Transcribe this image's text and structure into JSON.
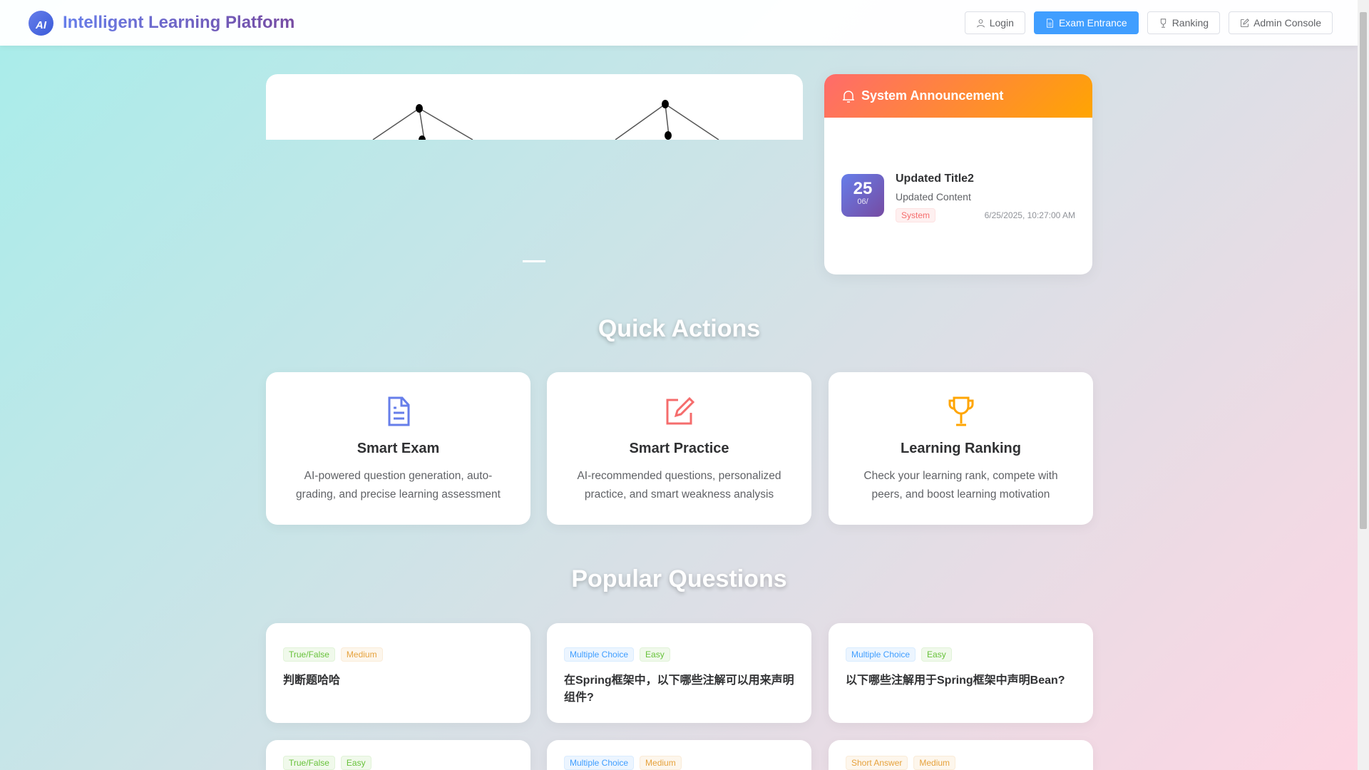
{
  "header": {
    "logo_text": "AI",
    "title": "Intelligent Learning Platform",
    "nav": [
      {
        "label": "Login",
        "icon": "user-icon"
      },
      {
        "label": "Exam Entrance",
        "icon": "document-icon"
      },
      {
        "label": "Ranking",
        "icon": "trophy-icon"
      },
      {
        "label": "Admin Console",
        "icon": "edit-icon"
      }
    ]
  },
  "announcement": {
    "title": "System Announcement",
    "items": [
      {
        "day": "25",
        "month": "06/",
        "title": "Updated Title2",
        "content": "Updated Content",
        "tag": "System",
        "time": "6/25/2025, 10:27:00 AM"
      }
    ]
  },
  "quick_actions": {
    "title": "Quick Actions",
    "items": [
      {
        "title": "Smart Exam",
        "desc": "AI-powered question generation, auto-grading, and precise learning assessment",
        "color": "#667eea"
      },
      {
        "title": "Smart Practice",
        "desc": "AI-recommended questions, personalized practice, and smart weakness analysis",
        "color": "#f56c6c"
      },
      {
        "title": "Learning Ranking",
        "desc": "Check your learning rank, compete with peers, and boost learning motivation",
        "color": "#ffa502"
      }
    ]
  },
  "popular": {
    "title": "Popular Questions",
    "items": [
      {
        "type": "True/False",
        "level": "Medium",
        "text": "判断题哈哈"
      },
      {
        "type": "Multiple Choice",
        "level": "Easy",
        "text": "在Spring框架中，以下哪些注解可以用来声明组件?"
      },
      {
        "type": "Multiple Choice",
        "level": "Easy",
        "text": "以下哪些注解用于Spring框架中声明Bean?"
      },
      {
        "type": "True/False",
        "level": "Easy",
        "text": ""
      },
      {
        "type": "Multiple Choice",
        "level": "Medium",
        "text": ""
      },
      {
        "type": "Short Answer",
        "level": "Medium",
        "text": ""
      }
    ]
  }
}
